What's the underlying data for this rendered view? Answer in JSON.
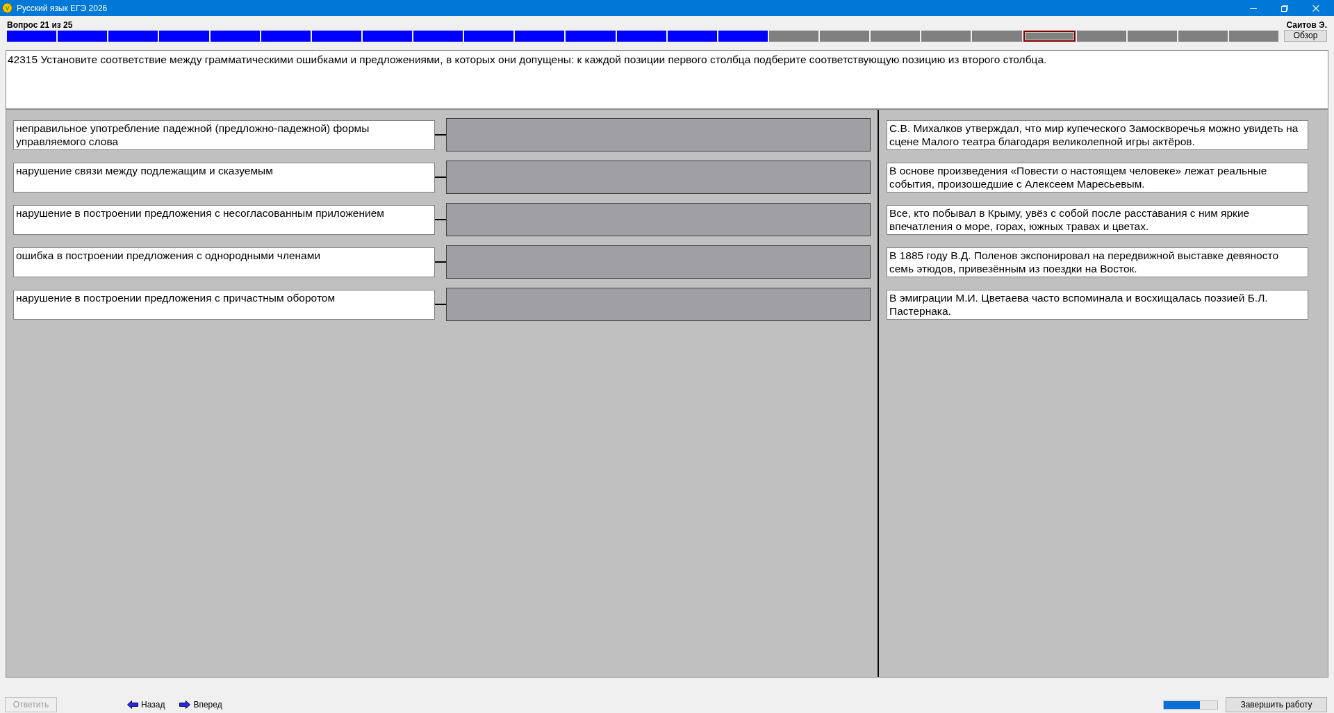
{
  "window": {
    "title": "Русский язык ЕГЭ 2026"
  },
  "header": {
    "question_counter": "Вопрос 21 из 25",
    "user_name": "Саитов Э.",
    "overview_button": "Обзор"
  },
  "question_progress": [
    {
      "answered": true,
      "selected": false
    },
    {
      "answered": true,
      "selected": false
    },
    {
      "answered": true,
      "selected": false
    },
    {
      "answered": true,
      "selected": false
    },
    {
      "answered": true,
      "selected": false
    },
    {
      "answered": true,
      "selected": false
    },
    {
      "answered": true,
      "selected": false
    },
    {
      "answered": true,
      "selected": false
    },
    {
      "answered": true,
      "selected": false
    },
    {
      "answered": true,
      "selected": false
    },
    {
      "answered": true,
      "selected": false
    },
    {
      "answered": true,
      "selected": false
    },
    {
      "answered": true,
      "selected": false
    },
    {
      "answered": true,
      "selected": false
    },
    {
      "answered": true,
      "selected": false
    },
    {
      "answered": false,
      "selected": false
    },
    {
      "answered": false,
      "selected": false
    },
    {
      "answered": false,
      "selected": false
    },
    {
      "answered": false,
      "selected": false
    },
    {
      "answered": false,
      "selected": false
    },
    {
      "answered": false,
      "selected": true
    },
    {
      "answered": false,
      "selected": false
    },
    {
      "answered": false,
      "selected": false
    },
    {
      "answered": false,
      "selected": false
    },
    {
      "answered": false,
      "selected": false
    }
  ],
  "question_text": "42315 Установите соответствие между грамматическими ошибками и предложениями, в которых они допущены: к каждой позиции первого столбца подберите соответствующую позицию из второго столбца.",
  "matching": {
    "left_items": [
      "неправильное употребление падежной (предложно-падежной) формы управляемого слова",
      "нарушение связи между подлежащим и сказуемым",
      "нарушение в построении предложения с несогласованным приложением",
      "ошибка в построении предложения с однородными членами",
      "нарушение в построении предложения с причастным оборотом"
    ],
    "right_items": [
      "С.В. Михалков утверждал, что мир купеческого Замоскворечья можно увидеть на сцене Малого театра благодаря великолепной игры актёров.",
      "В основе произведения «Повести о настоящем человеке» лежат реальные события, произошедшие с Алексеем Маресьевым.",
      "Все, кто побывал в Крыму, увёз с собой после расставания с ним яркие впечатления о море, горах, южных травах и цветах.",
      "В 1885 году В.Д. Поленов экспонировал на передвижной выставке девяносто семь этюдов, привезённым из поездки на Восток.",
      "В эмиграции М.И. Цветаева часто вспоминала и восхищалась поэзией Б.Л. Пастернака."
    ]
  },
  "bottom_bar": {
    "answer_button": {
      "label": "Ответить",
      "disabled": true
    },
    "back_button": "Назад",
    "forward_button": "Вперед",
    "timer": {
      "level": 0.68
    },
    "finish_button": "Завершить работу"
  }
}
